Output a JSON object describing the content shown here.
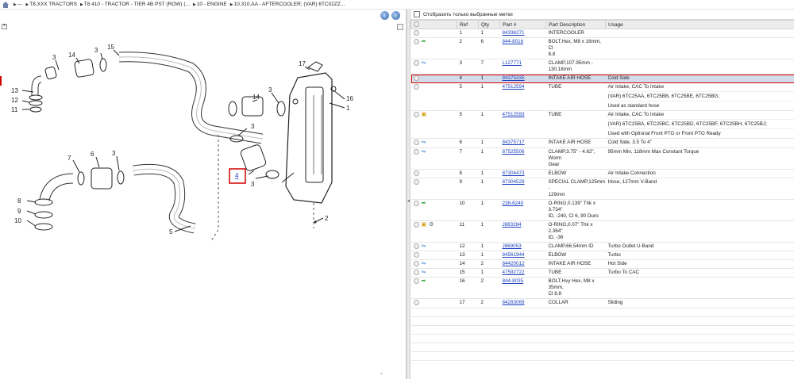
{
  "breadcrumb": {
    "items": [
      "---",
      "T8.XXX TRACTORS",
      "T8.410 - TRACTOR - TIER 4B PST (ROW) (...",
      "10 - ENGINE",
      "10.310.AA - AFTERCOOLER; (VAR) 6TC02ZZ..."
    ]
  },
  "filter": {
    "label": "Отобразить только выбранные метки"
  },
  "columns": [
    "",
    "Ref",
    "Qty",
    "Part #",
    "Part Description",
    "Usage"
  ],
  "diagram": {
    "callouts": [
      "3",
      "14",
      "3",
      "15",
      "13",
      "12",
      "11",
      "17",
      "16",
      "1",
      "3",
      "14",
      "3",
      "7",
      "6",
      "3",
      "8",
      "9",
      "10",
      "4",
      "3",
      "5",
      "2"
    ]
  },
  "rows": [
    {
      "icons": [],
      "ref": "1",
      "qty": "1",
      "part": "84336271",
      "desc": [
        "INTERCOOLER"
      ],
      "usage": [
        ""
      ]
    },
    {
      "icons": [
        "green-arrow"
      ],
      "ref": "2",
      "qty": "6",
      "part": "844-8016",
      "desc": [
        "BOLT,Hex, M8 x 16mm, Cl",
        "8.8"
      ],
      "usage": [
        ""
      ]
    },
    {
      "icons": [
        "blue-link"
      ],
      "ref": "3",
      "qty": "7",
      "part": "L127771",
      "desc": [
        "CLAMP,107.95mm -",
        "130.18mm"
      ],
      "usage": [
        ""
      ]
    },
    {
      "icons": [],
      "ref": "4",
      "qty": "1",
      "part": "84375335",
      "desc": [
        "INTAKE AIR HOSE"
      ],
      "usage": [
        "Cold Side"
      ],
      "selected": true
    },
    {
      "icons": [],
      "ref": "5",
      "qty": "1",
      "part": "47512594",
      "desc": [
        "TUBE"
      ],
      "usage": [
        "Air Intake, CAC To Intake",
        "(VAR) 6TC25AA, 6TC25BB, 6TC25BE, 6TC25BG;",
        "Used as standard hose"
      ]
    },
    {
      "icons": [
        "yellow-box"
      ],
      "ref": "5",
      "qty": "1",
      "part": "47512593",
      "desc": [
        "TUBE"
      ],
      "usage": [
        "Air Intake, CAC To Intake",
        "(VAR) 6TC25BA, 6TC25BC, 6TC25BD, 6TC25BF, 6TC25BH, 6TC25BJ;",
        "Used with Optional Front PTO or Front PTO Ready"
      ]
    },
    {
      "icons": [
        "blue-link"
      ],
      "ref": "6",
      "qty": "1",
      "part": "84375717",
      "desc": [
        "INTAKE AIR HOSE"
      ],
      "usage": [
        "Cold Side, 3.5 To 4\""
      ]
    },
    {
      "icons": [
        "blue-link"
      ],
      "ref": "7",
      "qty": "1",
      "part": "87525506",
      "desc": [
        "CLAMP,3.75\" - 4.62\", Worm",
        "Gear"
      ],
      "usage": [
        "95mm Min, 118mm Max Constant Torque"
      ]
    },
    {
      "icons": [],
      "ref": "8",
      "qty": "1",
      "part": "87304473",
      "desc": [
        "ELBOW"
      ],
      "usage": [
        "Air Intake Connection"
      ]
    },
    {
      "icons": [],
      "ref": "9",
      "qty": "1",
      "part": "87304529",
      "desc": [
        "SPECIAL CLAMP,125mm -",
        "129mm"
      ],
      "usage": [
        "Hose, 127mm V-Band"
      ]
    },
    {
      "icons": [
        "green-arrow"
      ],
      "ref": "10",
      "qty": "1",
      "part": "238-6240",
      "desc": [
        "O-RING,0.139\" Thk x 3.734\"",
        "ID, -240, Cl 6, 90 Duro"
      ],
      "usage": [
        ""
      ]
    },
    {
      "icons": [
        "yellow-box",
        "gray-gear"
      ],
      "ref": "11",
      "qty": "1",
      "part": "J883284",
      "desc": [
        "O-RING,0.07\" Thk x 2.364\"",
        "ID, -36"
      ],
      "usage": [
        ""
      ]
    },
    {
      "icons": [
        "blue-link"
      ],
      "ref": "12",
      "qty": "1",
      "part": "J869053",
      "desc": [
        "CLAMP,66.54mm ID"
      ],
      "usage": [
        "Turbo Outlet U-Band"
      ]
    },
    {
      "icons": [],
      "ref": "13",
      "qty": "1",
      "part": "84561944",
      "desc": [
        "ELBOW"
      ],
      "usage": [
        "Turbo"
      ]
    },
    {
      "icons": [
        "blue-link"
      ],
      "ref": "14",
      "qty": "2",
      "part": "84420012",
      "desc": [
        "INTAKE AIR HOSE"
      ],
      "usage": [
        "Hot Side"
      ]
    },
    {
      "icons": [
        "blue-link"
      ],
      "ref": "15",
      "qty": "1",
      "part": "47592722",
      "desc": [
        "TUBE"
      ],
      "usage": [
        "Turbo To CAC"
      ]
    },
    {
      "icons": [
        "green-arrow"
      ],
      "ref": "16",
      "qty": "2",
      "part": "844-8035",
      "desc": [
        "BOLT,Hvy Hex, M8 x 35mm,",
        "Cl 8.8"
      ],
      "usage": [
        ""
      ]
    },
    {
      "icons": [],
      "ref": "17",
      "qty": "2",
      "part": "84283069",
      "desc": [
        "COLLAR"
      ],
      "usage": [
        "Sliding"
      ]
    }
  ]
}
